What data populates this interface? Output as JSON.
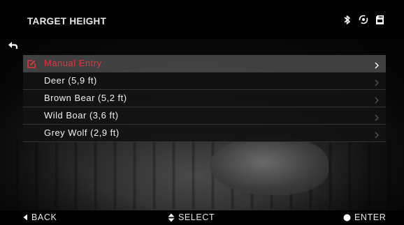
{
  "header": {
    "title": "TARGET HEIGHT",
    "status_icons": [
      "bluetooth-icon",
      "wifi-icon",
      "sd-card-icon"
    ]
  },
  "menu": {
    "items": [
      {
        "label": "Manual Entry",
        "selected": true,
        "icon": "edit-icon"
      },
      {
        "label": "Deer (5,9 ft)"
      },
      {
        "label": "Brown Bear (5,2 ft)"
      },
      {
        "label": "Wild Boar (3,6 ft)"
      },
      {
        "label": "Grey Wolf (2,9 ft)"
      }
    ]
  },
  "footer": {
    "back_label": "BACK",
    "select_label": "SELECT",
    "enter_label": "ENTER"
  },
  "colors": {
    "accent": "#e8343a",
    "text": "#e6e6e6"
  }
}
